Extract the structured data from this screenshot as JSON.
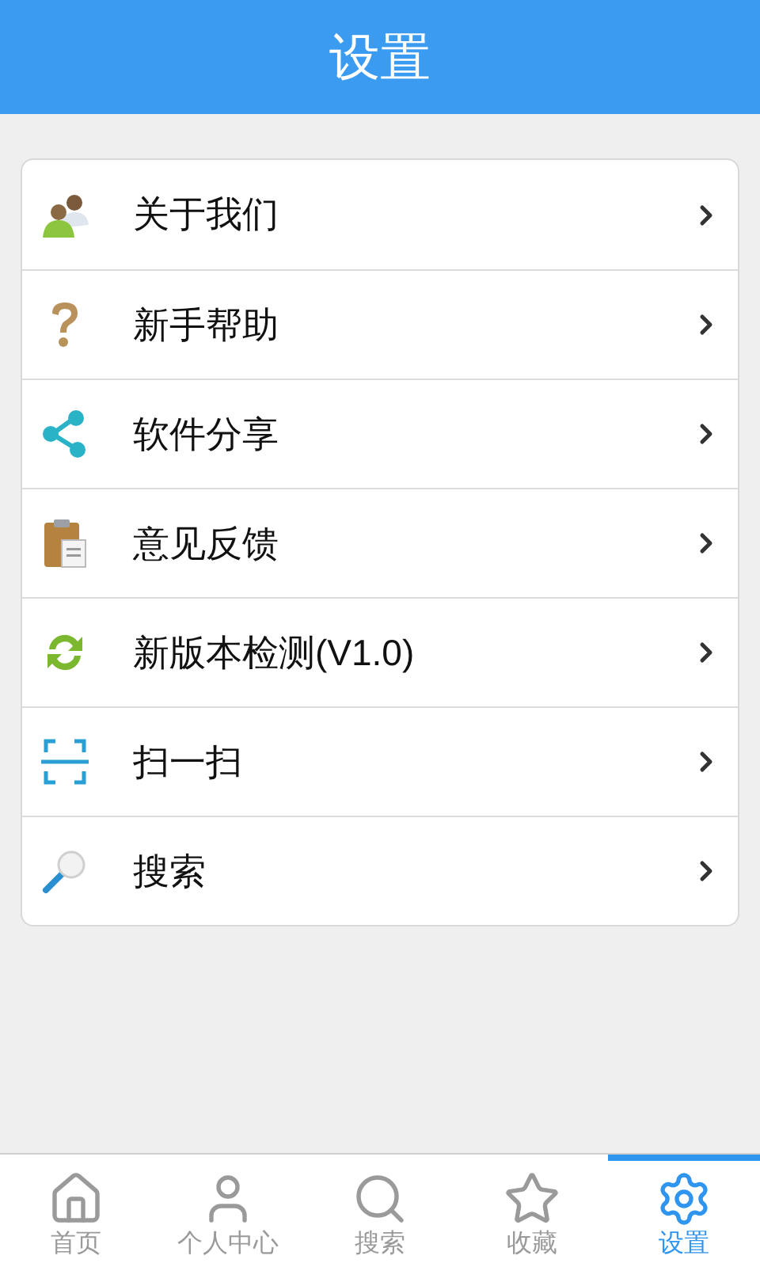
{
  "header": {
    "title": "设置"
  },
  "menu": [
    {
      "label": "关于我们"
    },
    {
      "label": "新手帮助"
    },
    {
      "label": "软件分享"
    },
    {
      "label": "意见反馈"
    },
    {
      "label": "新版本检测(V1.0)"
    },
    {
      "label": "扫一扫"
    },
    {
      "label": "搜索"
    }
  ],
  "tabs": [
    {
      "label": "首页",
      "selected": false
    },
    {
      "label": "个人中心",
      "selected": false
    },
    {
      "label": "搜索",
      "selected": false
    },
    {
      "label": "收藏",
      "selected": false
    },
    {
      "label": "设置",
      "selected": true
    }
  ]
}
